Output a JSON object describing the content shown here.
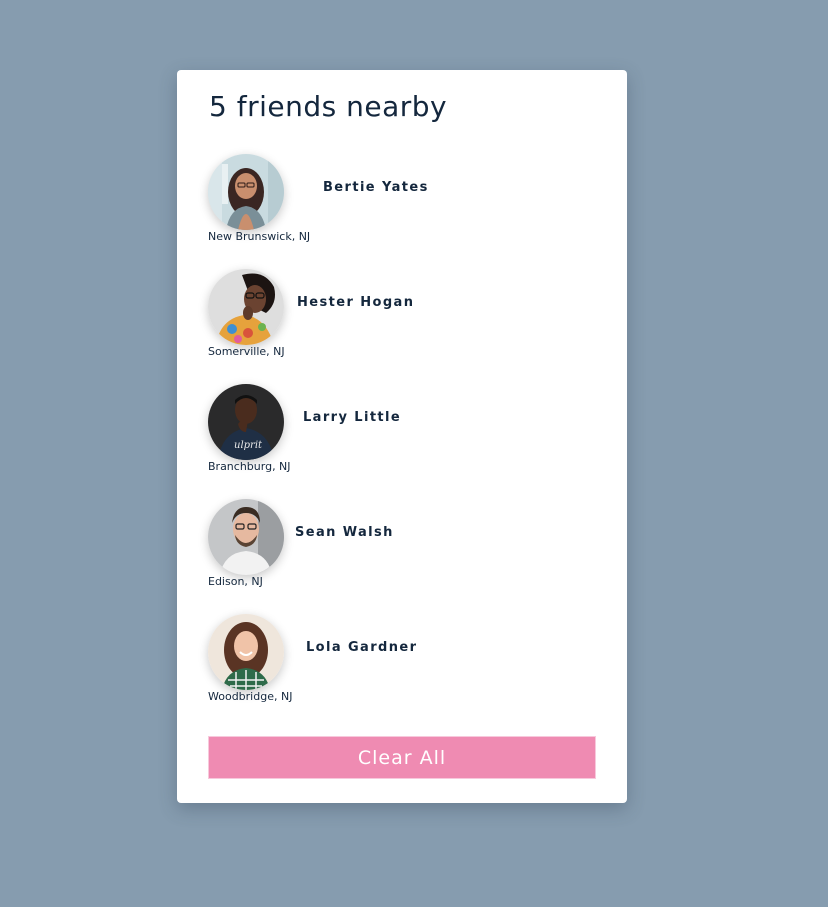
{
  "header": {
    "title": "5 friends nearby"
  },
  "friends": [
    {
      "name": "Bertie Yates",
      "location": "New Brunswick, NJ"
    },
    {
      "name": "Hester Hogan",
      "location": "Somerville, NJ"
    },
    {
      "name": "Larry Little",
      "location": "Branchburg, NJ"
    },
    {
      "name": "Sean Walsh",
      "location": "Edison, NJ"
    },
    {
      "name": "Lola Gardner",
      "location": "Woodbridge, NJ"
    }
  ],
  "actions": {
    "clear_label": "Clear All"
  },
  "colors": {
    "background": "#869caf",
    "card": "#ffffff",
    "text": "#14273d",
    "button": "#ef8bb2"
  }
}
